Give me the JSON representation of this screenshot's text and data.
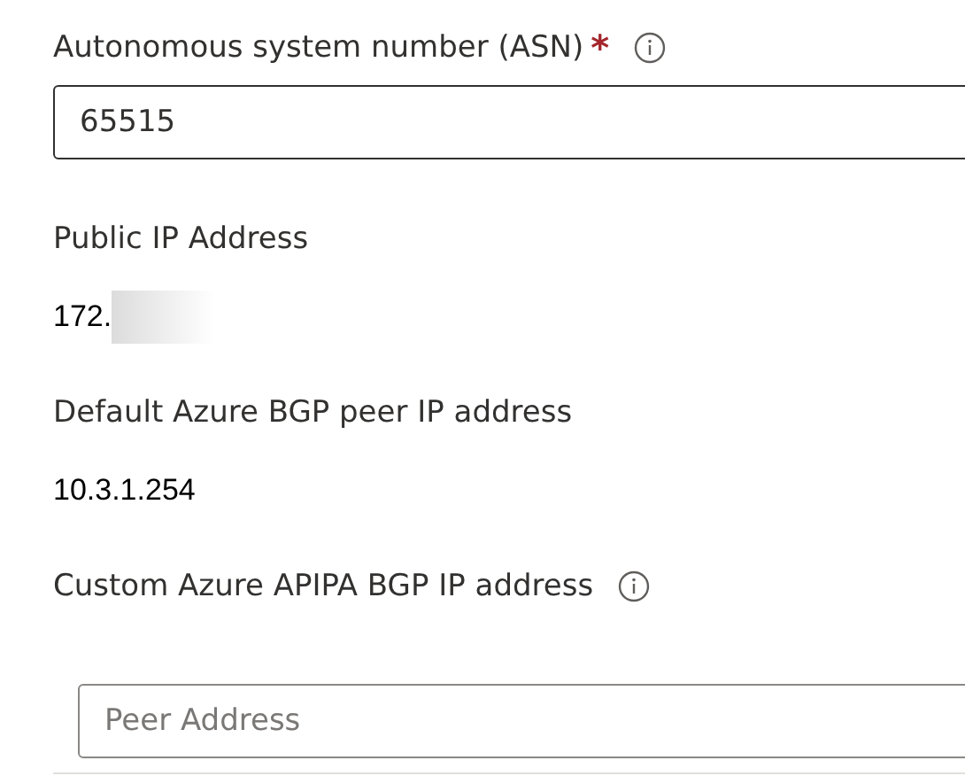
{
  "fields": [
    {
      "kind": "input",
      "label": "Autonomous system number (ASN)",
      "required": true,
      "info": true,
      "value": "65515"
    },
    {
      "kind": "text",
      "label": "Public IP Address",
      "value": "172.",
      "redacted": true
    },
    {
      "kind": "text",
      "label": "Default Azure BGP peer IP address",
      "value": "10.3.1.254"
    },
    {
      "kind": "input",
      "label": "Custom Azure APIPA BGP IP address",
      "info": true,
      "indented": true,
      "placeholder": "Peer Address"
    }
  ],
  "required_mark": "*"
}
